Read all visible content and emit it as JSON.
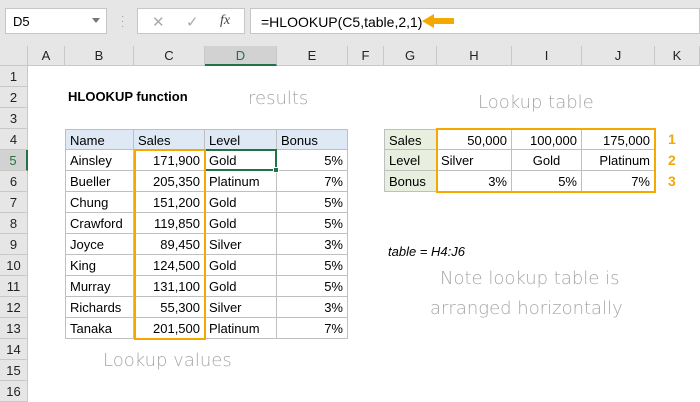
{
  "namebox": "D5",
  "formula_bar": {
    "cancel": "✕",
    "enter": "✓",
    "fx": "fx",
    "formula": "=HLOOKUP(C5,table,2,1)"
  },
  "columns": [
    "A",
    "B",
    "C",
    "D",
    "E",
    "F",
    "G",
    "H",
    "I",
    "J",
    "K"
  ],
  "rows": [
    "1",
    "2",
    "3",
    "4",
    "5",
    "6",
    "7",
    "8",
    "9",
    "10",
    "11",
    "12",
    "13",
    "14",
    "15",
    "16"
  ],
  "title": "HLOOKUP function",
  "main_table": {
    "headers": [
      "Name",
      "Sales",
      "Level",
      "Bonus"
    ],
    "rows": [
      [
        "Ainsley",
        "171,900",
        "Gold",
        "5%"
      ],
      [
        "Bueller",
        "205,350",
        "Platinum",
        "7%"
      ],
      [
        "Chung",
        "151,200",
        "Gold",
        "5%"
      ],
      [
        "Crawford",
        "119,850",
        "Gold",
        "5%"
      ],
      [
        "Joyce",
        "89,450",
        "Silver",
        "3%"
      ],
      [
        "King",
        "124,500",
        "Gold",
        "5%"
      ],
      [
        "Murray",
        "131,100",
        "Gold",
        "5%"
      ],
      [
        "Richards",
        "55,300",
        "Silver",
        "3%"
      ],
      [
        "Tanaka",
        "201,500",
        "Platinum",
        "7%"
      ]
    ]
  },
  "lookup_table": {
    "rows": [
      [
        "Sales",
        "50,000",
        "100,000",
        "175,000"
      ],
      [
        "Level",
        "Silver",
        "Gold",
        "Platinum"
      ],
      [
        "Bonus",
        "3%",
        "5%",
        "7%"
      ]
    ],
    "row_numbers": [
      "1",
      "2",
      "3"
    ]
  },
  "named_range": "table = H4:J6",
  "annotations": {
    "results": "results",
    "lookup_table": "Lookup table",
    "lookup_values": "Lookup values",
    "note_line1": "Note lookup table is",
    "note_line2": "arranged horizontally"
  },
  "colors": {
    "accent": "#f5a800",
    "excel_green": "#217346"
  }
}
